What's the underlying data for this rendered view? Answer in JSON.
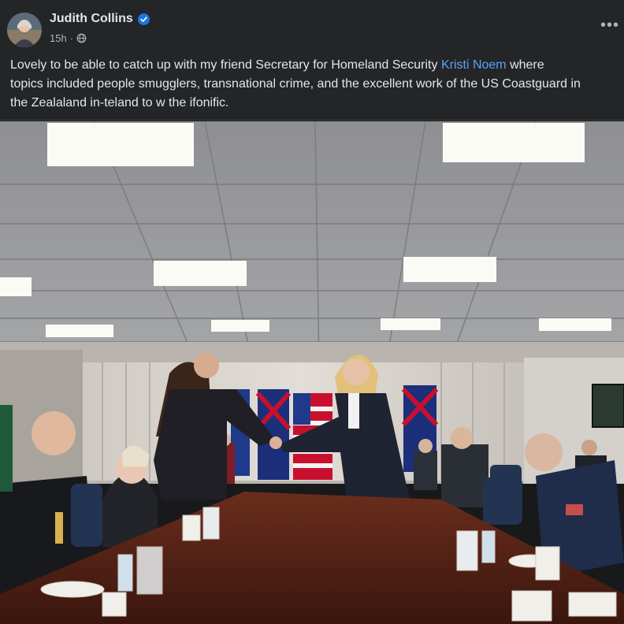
{
  "author": {
    "name": "Judith Collins",
    "verified_icon": "verified-badge-icon"
  },
  "meta": {
    "time": "15h",
    "separator": "·",
    "audience_icon": "globe-icon"
  },
  "menu_icon": "more-options-icon",
  "colors": {
    "accent": "#1b74e4",
    "mention": "#5ea1ff",
    "background": "#242526",
    "text": "#e4e6eb"
  },
  "post": {
    "line1_before": "Lovely to be able to catch up with  my friend Secretary for Homeland Security ",
    "mention": "Kristi Noem",
    "line1_after": "  where",
    "line2": "topics included people smugglers, transnational crime, and the excellent work of the US Coastguard in",
    "line3": "the Zealaland in-teland to w the ifonific."
  }
}
